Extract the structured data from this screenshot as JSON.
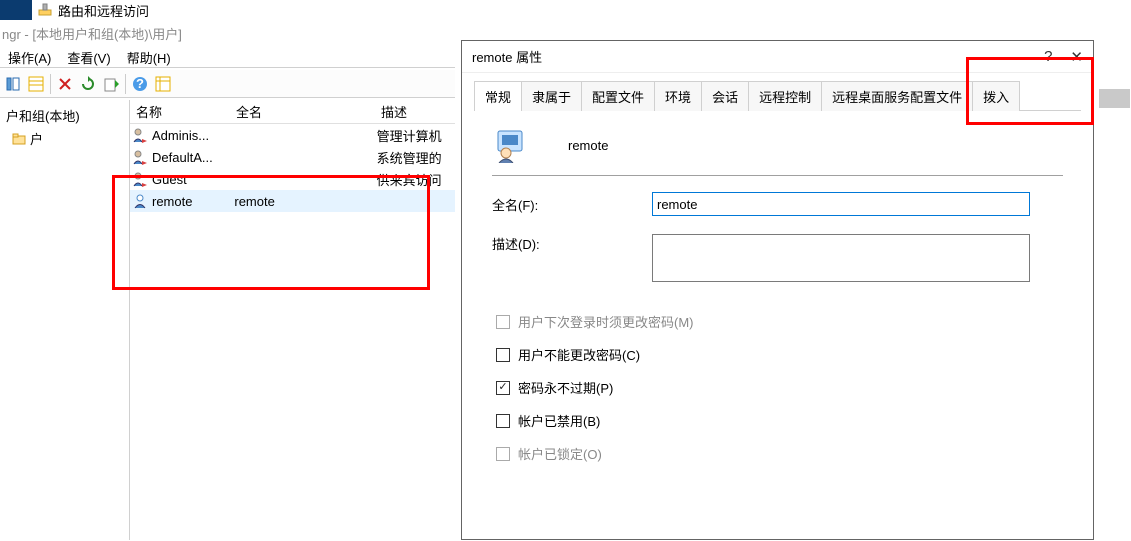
{
  "taskbar": {
    "label": "路由和远程访问"
  },
  "mmc_title": "ngr - [本地用户和组(本地)\\用户]",
  "menu": {
    "action": "操作(A)",
    "view": "查看(V)",
    "help": "帮助(H)"
  },
  "tree": {
    "root_label": "户和组(本地)",
    "folder_label": "户"
  },
  "list": {
    "columns": {
      "name": "名称",
      "fullname": "全名",
      "desc": "描述"
    },
    "rows": [
      {
        "name": "Adminis...",
        "fullname": "",
        "desc": "管理计算机"
      },
      {
        "name": "DefaultA...",
        "fullname": "",
        "desc": "系统管理的"
      },
      {
        "name": "Guest",
        "fullname": "",
        "desc": "供来宾访问"
      },
      {
        "name": "remote",
        "fullname": "remote",
        "desc": ""
      }
    ]
  },
  "dialog": {
    "title": "remote 属性",
    "help": "?",
    "close": "✕",
    "tabs": {
      "general": "常规",
      "memberof": "隶属于",
      "profile": "配置文件",
      "env": "环境",
      "session": "会话",
      "remotectl": "远程控制",
      "rds": "远程桌面服务配置文件",
      "dialin": "拨入"
    },
    "username": "remote",
    "fullname_label": "全名(F):",
    "fullname_value": "remote",
    "desc_label": "描述(D):",
    "chk_mustchange": "用户下次登录时须更改密码(M)",
    "chk_cannotchange": "用户不能更改密码(C)",
    "chk_neverexpire": "密码永不过期(P)",
    "chk_disabled": "帐户已禁用(B)",
    "chk_locked": "帐户已锁定(O)"
  }
}
